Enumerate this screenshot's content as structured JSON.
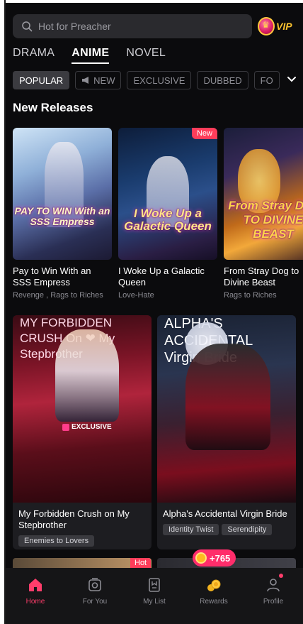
{
  "search": {
    "placeholder": "Hot for Preacher"
  },
  "vip": {
    "label": "VIP"
  },
  "tabs": [
    {
      "label": "DRAMA",
      "active": false
    },
    {
      "label": "ANIME",
      "active": true
    },
    {
      "label": "NOVEL",
      "active": false
    }
  ],
  "chips": [
    {
      "label": "POPULAR",
      "active": true
    },
    {
      "label": "NEW",
      "icon": "megaphone-icon"
    },
    {
      "label": "EXCLUSIVE"
    },
    {
      "label": "DUBBED"
    },
    {
      "label": "FO"
    }
  ],
  "section": {
    "title": "New Releases"
  },
  "new_releases": [
    {
      "title": "Pay to Win With an SSS Empress",
      "tags": "Revenge , Rags to Riches",
      "cover_text": "PAY TO WIN With an SSS Empress",
      "badge": ""
    },
    {
      "title": "I Woke Up a Galactic Queen",
      "tags": "Love-Hate",
      "cover_text": "I Woke Up a Galactic Queen",
      "badge": "New"
    },
    {
      "title": "From Stray Dog to Divine Beast",
      "tags": "Rags to Riches",
      "cover_text": "From Stray Dog TO DIVINE BEAST",
      "badge": ""
    }
  ],
  "grid": [
    {
      "title": "My Forbidden Crush on My Stepbrother",
      "tags": [
        "Enemies to Lovers"
      ],
      "exclusive_label": "EXCLUSIVE",
      "cover_text": "MY FORBIDDEN CRUSH On ❤ My Stepbrother"
    },
    {
      "title": "Alpha's Accidental Virgin Bride",
      "tags": [
        "Identity Twist",
        "Serendipity"
      ],
      "cover_text": "ALPHA'S ACCIDENTAL Virgin Bride"
    }
  ],
  "peek": {
    "hot_label": "Hot"
  },
  "reward_pill": {
    "label": "+765"
  },
  "nav": [
    {
      "label": "Home",
      "icon": "home-icon",
      "active": true
    },
    {
      "label": "For You",
      "icon": "for-you-icon",
      "active": false
    },
    {
      "label": "My List",
      "icon": "my-list-icon",
      "active": false
    },
    {
      "label": "Rewards",
      "icon": "rewards-icon",
      "active": false
    },
    {
      "label": "Profile",
      "icon": "profile-icon",
      "active": false
    }
  ],
  "colors": {
    "accent": "#ff3d6b",
    "background": "#0b0b0d",
    "vip": "#f9c12e"
  }
}
